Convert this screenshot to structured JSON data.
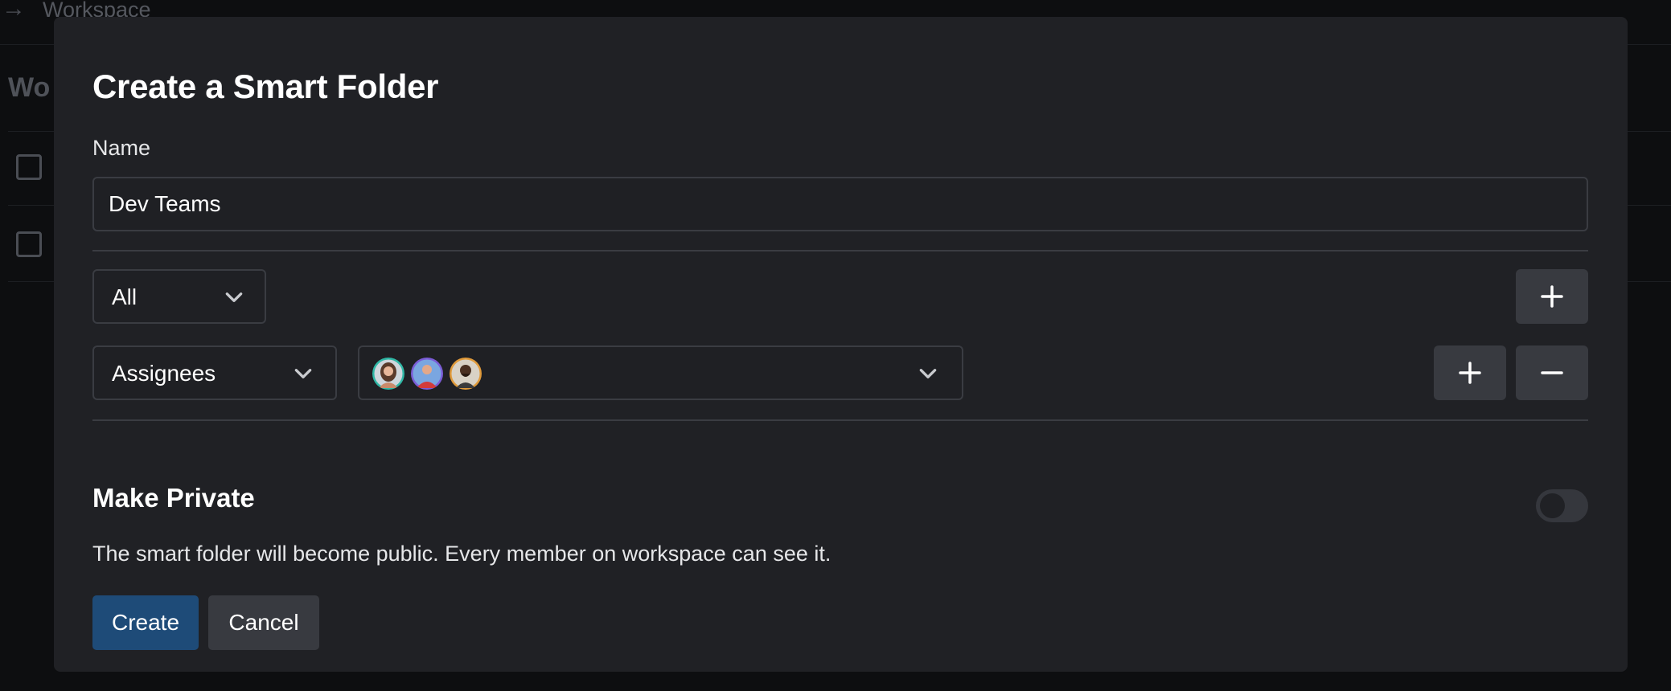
{
  "background": {
    "breadcrumb": "Workspace",
    "heading": "Wo"
  },
  "modal": {
    "title": "Create a Smart Folder",
    "name_label": "Name",
    "name_value": "Dev Teams",
    "match_select": {
      "value": "All"
    },
    "filter_row": {
      "field_select": {
        "value": "Assignees"
      },
      "assignees": [
        {
          "name": "avatar-woman",
          "ring": "#2fb8a6"
        },
        {
          "name": "avatar-man-red-shirt",
          "ring": "#7b5cd6"
        },
        {
          "name": "avatar-man-beard",
          "ring": "#e09a3a"
        }
      ]
    },
    "private": {
      "title": "Make Private",
      "description": "The smart folder will become public. Every member on workspace can see it.",
      "enabled": false
    },
    "buttons": {
      "create": "Create",
      "cancel": "Cancel"
    }
  },
  "colors": {
    "accent": "#1e4b78",
    "modal_bg": "#202125",
    "border": "#3a3c42"
  },
  "icons": [
    "chevron-down-icon",
    "plus-icon",
    "minus-icon",
    "arrow-right-icon"
  ]
}
